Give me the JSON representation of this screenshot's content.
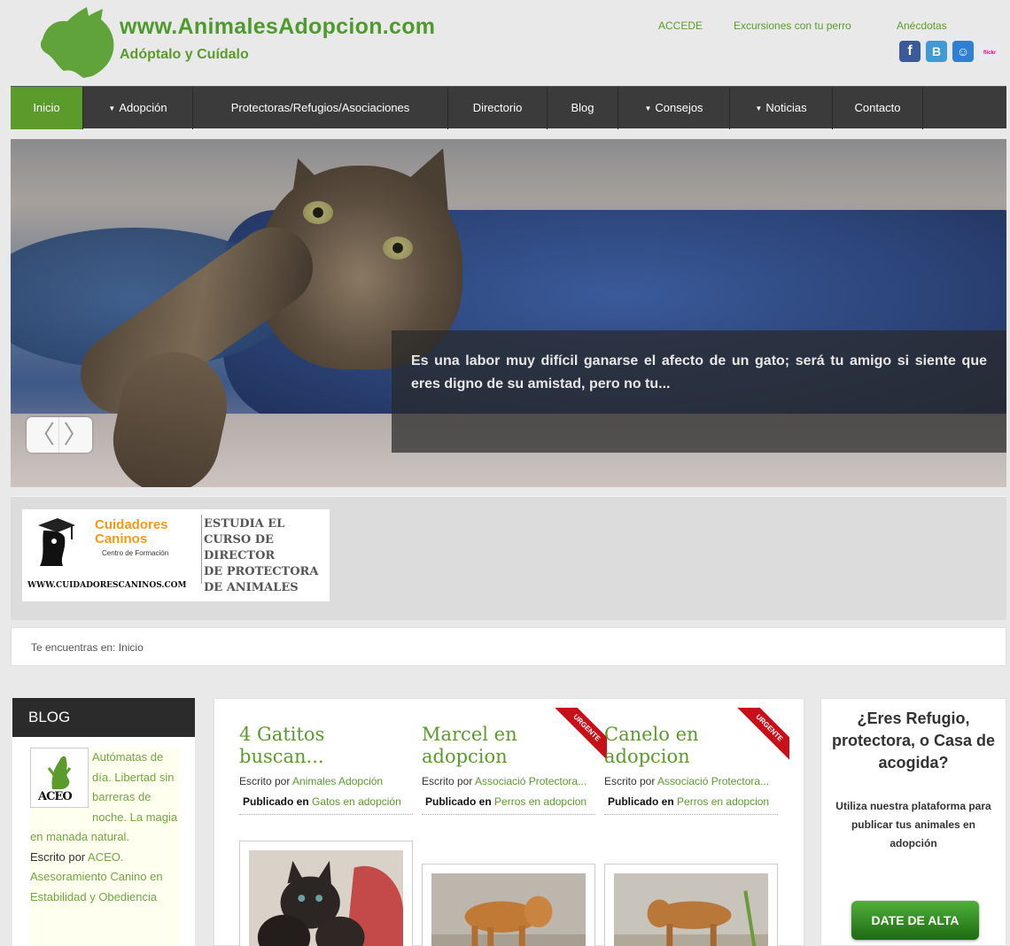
{
  "header": {
    "site_title": "www.AnimalesAdopcion.com",
    "tagline": "Adóptalo y Cuídalo",
    "top_links": [
      "ACCEDE",
      "Excursiones con tu perro",
      "Anécdotas"
    ],
    "social_icons": [
      "facebook-icon",
      "blogger-icon",
      "delicious-icon",
      "flickr-icon"
    ],
    "social_glyphs": [
      "f",
      "B",
      "☺",
      "flickr"
    ],
    "brand_color": "#5a9b2b"
  },
  "nav": {
    "items": [
      {
        "label": "Inicio",
        "dropdown": false,
        "active": true
      },
      {
        "label": "Adopción",
        "dropdown": true,
        "active": false
      },
      {
        "label": "Protectoras/Refugios/Asociaciones",
        "dropdown": false,
        "active": false
      },
      {
        "label": "Directorio",
        "dropdown": false,
        "active": false
      },
      {
        "label": "Blog",
        "dropdown": false,
        "active": false
      },
      {
        "label": "Consejos",
        "dropdown": true,
        "active": false
      },
      {
        "label": "Noticias",
        "dropdown": true,
        "active": false
      },
      {
        "label": "Contacto",
        "dropdown": false,
        "active": false
      }
    ],
    "dropdown_arrow": "▼"
  },
  "hero": {
    "caption": "Es una labor muy difícil ganarse el afecto de un gato; será tu amigo si siente que eres digno de su amistad, pero no tu...",
    "prev": "〈",
    "next": "〉"
  },
  "ad": {
    "brand_line1": "Cuidadores",
    "brand_line2": "Caninos",
    "brand_sub": "Centro de Formación",
    "course_lines": [
      "ESTUDIA EL",
      "CURSO DE",
      "DIRECTOR",
      "DE PROTECTORA",
      "DE ANIMALES"
    ],
    "url": "WWW.CUIDADORESCANINOS.COM"
  },
  "breadcrumb": {
    "text": "Te encuentras en: Inicio"
  },
  "blog": {
    "heading": "BLOG",
    "thumb_label": "ACEO",
    "text": "Autómatas de día. Libertad sin barreras de noche. La magia en manada natural.",
    "author_prefix": "Escrito por",
    "author": "ACEO. Asesoramiento Canino en Estabilidad y Obediencia"
  },
  "articles": [
    {
      "title": "4 Gatitos buscan...",
      "author_prefix": "Escrito por",
      "author": "Animales Adopción",
      "category_prefix": "Publicado en",
      "category": "Gatos en adopción",
      "urgent": false
    },
    {
      "title": "Marcel en adopcion",
      "author_prefix": "Escrito por",
      "author": "Associació Protectora...",
      "category_prefix": "Publicado en",
      "category": "Perros en adopcion",
      "urgent": true
    },
    {
      "title": "Canelo en adopcion",
      "author_prefix": "Escrito por",
      "author": "Associació Protectora...",
      "category_prefix": "Publicado en",
      "category": "Perros en adopcion",
      "urgent": true
    }
  ],
  "urgent_label": "URGENTE",
  "sidebar_right": {
    "title": "¿Eres Refugio, protectora, o Casa de acogida?",
    "text": "Utiliza nuestra plataforma para publicar tus animales en adopción",
    "cta": "DATE DE ALTA"
  }
}
